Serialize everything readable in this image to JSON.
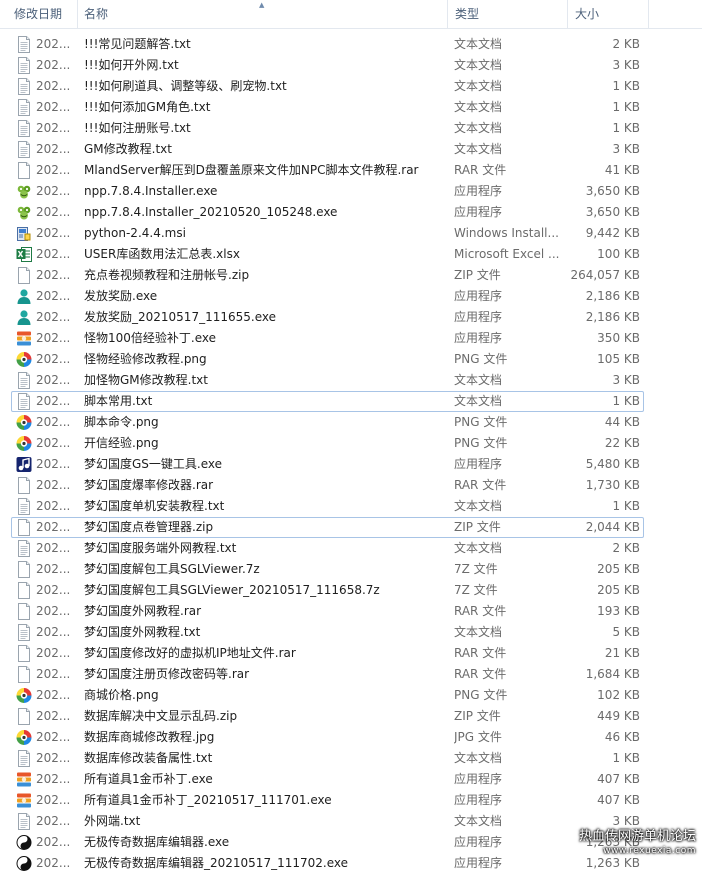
{
  "columns": {
    "date": "修改日期",
    "name": "名称",
    "type": "类型",
    "size": "大小"
  },
  "rows": [
    {
      "date": "202...",
      "name": "!!!常见问题解答.txt",
      "type": "文本文档",
      "size": "2 KB",
      "icon": "text-file-icon"
    },
    {
      "date": "202...",
      "name": "!!!如何开外网.txt",
      "type": "文本文档",
      "size": "3 KB",
      "icon": "text-file-icon"
    },
    {
      "date": "202...",
      "name": "!!!如何刷道具、调整等级、刷宠物.txt",
      "type": "文本文档",
      "size": "1 KB",
      "icon": "text-file-icon"
    },
    {
      "date": "202...",
      "name": "!!!如何添加GM角色.txt",
      "type": "文本文档",
      "size": "1 KB",
      "icon": "text-file-icon"
    },
    {
      "date": "202...",
      "name": "!!!如何注册账号.txt",
      "type": "文本文档",
      "size": "1 KB",
      "icon": "text-file-icon"
    },
    {
      "date": "202...",
      "name": "GM修改教程.txt",
      "type": "文本文档",
      "size": "3 KB",
      "icon": "text-file-icon"
    },
    {
      "date": "202...",
      "name": "MlandServer解压到D盘覆盖原来文件加NPC脚本文件教程.rar",
      "type": "RAR 文件",
      "size": "41 KB",
      "icon": "blank-file-icon"
    },
    {
      "date": "202...",
      "name": "npp.7.8.4.Installer.exe",
      "type": "应用程序",
      "size": "3,650 KB",
      "icon": "notepadpp-icon"
    },
    {
      "date": "202...",
      "name": "npp.7.8.4.Installer_20210520_105248.exe",
      "type": "应用程序",
      "size": "3,650 KB",
      "icon": "notepadpp-icon"
    },
    {
      "date": "202...",
      "name": "python-2.4.4.msi",
      "type": "Windows Install...",
      "size": "9,442 KB",
      "icon": "msi-installer-icon"
    },
    {
      "date": "202...",
      "name": "USER库函数用法汇总表.xlsx",
      "type": "Microsoft Excel ...",
      "size": "100 KB",
      "icon": "excel-icon"
    },
    {
      "date": "202...",
      "name": "充点卷视频教程和注册帐号.zip",
      "type": "ZIP 文件",
      "size": "264,057 KB",
      "icon": "blank-file-icon"
    },
    {
      "date": "202...",
      "name": "发放奖励.exe",
      "type": "应用程序",
      "size": "2,186 KB",
      "icon": "user-app-icon"
    },
    {
      "date": "202...",
      "name": "发放奖励_20210517_111655.exe",
      "type": "应用程序",
      "size": "2,186 KB",
      "icon": "user-app-icon"
    },
    {
      "date": "202...",
      "name": "怪物100倍经验补丁.exe",
      "type": "应用程序",
      "size": "350 KB",
      "icon": "patch-app-icon"
    },
    {
      "date": "202...",
      "name": "怪物经验修改教程.png",
      "type": "PNG 文件",
      "size": "105 KB",
      "icon": "image-viewer-icon"
    },
    {
      "date": "202...",
      "name": "加怪物GM修改教程.txt",
      "type": "文本文档",
      "size": "3 KB",
      "icon": "text-file-icon"
    },
    {
      "date": "202...",
      "name": "脚本常用.txt",
      "type": "文本文档",
      "size": "1 KB",
      "icon": "text-file-icon",
      "boxed": true
    },
    {
      "date": "202...",
      "name": "脚本命令.png",
      "type": "PNG 文件",
      "size": "44 KB",
      "icon": "image-viewer-icon"
    },
    {
      "date": "202...",
      "name": "开信经验.png",
      "type": "PNG 文件",
      "size": "22 KB",
      "icon": "image-viewer-icon"
    },
    {
      "date": "202...",
      "name": "梦幻国度GS一键工具.exe",
      "type": "应用程序",
      "size": "5,480 KB",
      "icon": "tool-app-icon"
    },
    {
      "date": "202...",
      "name": "梦幻国度爆率修改器.rar",
      "type": "RAR 文件",
      "size": "1,730 KB",
      "icon": "blank-file-icon"
    },
    {
      "date": "202...",
      "name": "梦幻国度单机安装教程.txt",
      "type": "文本文档",
      "size": "1 KB",
      "icon": "text-file-icon"
    },
    {
      "date": "202...",
      "name": "梦幻国度点卷管理器.zip",
      "type": "ZIP 文件",
      "size": "2,044 KB",
      "icon": "blank-file-icon",
      "boxed": true
    },
    {
      "date": "202...",
      "name": "梦幻国度服务端外网教程.txt",
      "type": "文本文档",
      "size": "2 KB",
      "icon": "text-file-icon"
    },
    {
      "date": "202...",
      "name": "梦幻国度解包工具SGLViewer.7z",
      "type": "7Z 文件",
      "size": "205 KB",
      "icon": "blank-file-icon"
    },
    {
      "date": "202...",
      "name": "梦幻国度解包工具SGLViewer_20210517_111658.7z",
      "type": "7Z 文件",
      "size": "205 KB",
      "icon": "blank-file-icon"
    },
    {
      "date": "202...",
      "name": "梦幻国度外网教程.rar",
      "type": "RAR 文件",
      "size": "193 KB",
      "icon": "blank-file-icon"
    },
    {
      "date": "202...",
      "name": "梦幻国度外网教程.txt",
      "type": "文本文档",
      "size": "5 KB",
      "icon": "text-file-icon"
    },
    {
      "date": "202...",
      "name": "梦幻国度修改好的虚拟机IP地址文件.rar",
      "type": "RAR 文件",
      "size": "21 KB",
      "icon": "blank-file-icon"
    },
    {
      "date": "202...",
      "name": "梦幻国度注册页修改密码等.rar",
      "type": "RAR 文件",
      "size": "1,684 KB",
      "icon": "blank-file-icon"
    },
    {
      "date": "202...",
      "name": "商城价格.png",
      "type": "PNG 文件",
      "size": "102 KB",
      "icon": "image-viewer-icon"
    },
    {
      "date": "202...",
      "name": "数据库解决中文显示乱码.zip",
      "type": "ZIP 文件",
      "size": "449 KB",
      "icon": "blank-file-icon"
    },
    {
      "date": "202...",
      "name": "数据库商城修改教程.jpg",
      "type": "JPG 文件",
      "size": "46 KB",
      "icon": "image-viewer-icon"
    },
    {
      "date": "202...",
      "name": "数据库修改装备属性.txt",
      "type": "文本文档",
      "size": "1 KB",
      "icon": "text-file-icon"
    },
    {
      "date": "202...",
      "name": "所有道具1金币补丁.exe",
      "type": "应用程序",
      "size": "407 KB",
      "icon": "patch-app-icon"
    },
    {
      "date": "202...",
      "name": "所有道具1金币补丁_20210517_111701.exe",
      "type": "应用程序",
      "size": "407 KB",
      "icon": "patch-app-icon"
    },
    {
      "date": "202...",
      "name": "外网端.txt",
      "type": "文本文档",
      "size": "3 KB",
      "icon": "text-file-icon"
    },
    {
      "date": "202...",
      "name": "无极传奇数据库编辑器.exe",
      "type": "应用程序",
      "size": "1,263 KB",
      "icon": "yinyang-app-icon"
    },
    {
      "date": "202...",
      "name": "无极传奇数据库编辑器_20210517_111702.exe",
      "type": "应用程序",
      "size": "1,263 KB",
      "icon": "yinyang-app-icon"
    }
  ],
  "watermark": {
    "line1": "热血传网游单机论坛",
    "line2": "www.rexuexia.com"
  }
}
